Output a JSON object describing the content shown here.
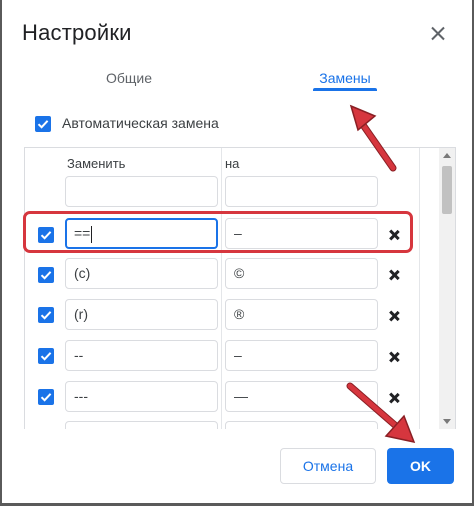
{
  "dialog": {
    "title": "Настройки",
    "close_icon": "close-icon"
  },
  "tabs": [
    {
      "label": "Общие",
      "selected": false
    },
    {
      "label": "Замены",
      "selected": true
    }
  ],
  "auto_replace": {
    "checked": true,
    "label": "Автоматическая замена"
  },
  "table": {
    "headers": {
      "replace": "Заменить",
      "with": "на"
    },
    "rows": [
      {
        "checked": null,
        "replace": "",
        "with": ""
      },
      {
        "checked": true,
        "replace": "==",
        "with": "–",
        "focused": true
      },
      {
        "checked": true,
        "replace": "(c)",
        "with": "©"
      },
      {
        "checked": true,
        "replace": "(r)",
        "with": "®"
      },
      {
        "checked": true,
        "replace": "--",
        "with": "–"
      },
      {
        "checked": true,
        "replace": "---",
        "with": "—"
      }
    ]
  },
  "buttons": {
    "cancel": "Отмена",
    "ok": "OK"
  },
  "colors": {
    "accent": "#1a73e8",
    "annotation": "#d6363e"
  }
}
